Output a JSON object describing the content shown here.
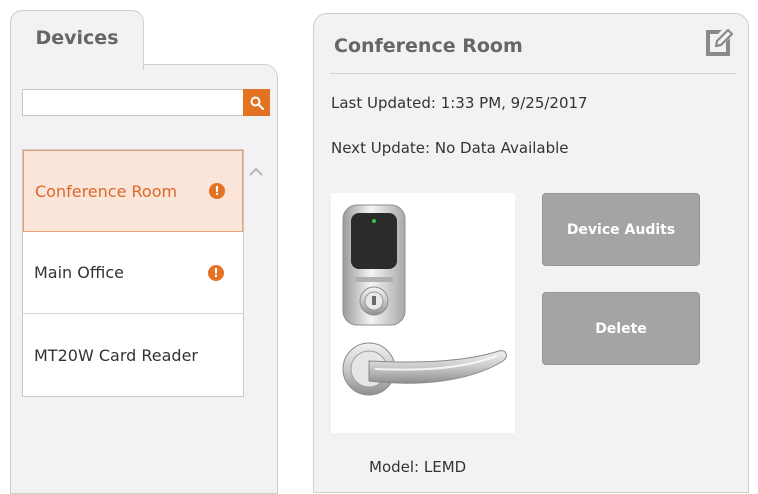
{
  "sidebar": {
    "tab_label": "Devices",
    "search": {
      "value": "",
      "placeholder": ""
    },
    "devices": [
      {
        "label": "Conference Room",
        "alert": "!",
        "selected": true
      },
      {
        "label": "Main Office",
        "alert": "!",
        "selected": false
      },
      {
        "label": "MT20W Card Reader",
        "alert": null,
        "selected": false
      }
    ]
  },
  "detail": {
    "title": "Conference Room",
    "last_updated_label": "Last Updated:",
    "last_updated_value": "1:33 PM, 9/25/2017",
    "next_update_label": "Next Update:",
    "next_update_value": "No Data Available",
    "device_audits_label": "Device Audits",
    "delete_label": "Delete",
    "model_label": "Model:",
    "model_value": "LEMD",
    "image_icon": "smart-lock-lever-image"
  },
  "icons": {
    "search": "search-icon",
    "edit": "edit-icon",
    "alert": "alert-icon",
    "scroll_up": "chevron-up-icon"
  },
  "colors": {
    "accent": "#e37222",
    "selected_bg": "#fbe4d8",
    "selected_text": "#d9692a",
    "button_gray": "#a4a4a4",
    "panel_bg": "#f2f2f2"
  }
}
